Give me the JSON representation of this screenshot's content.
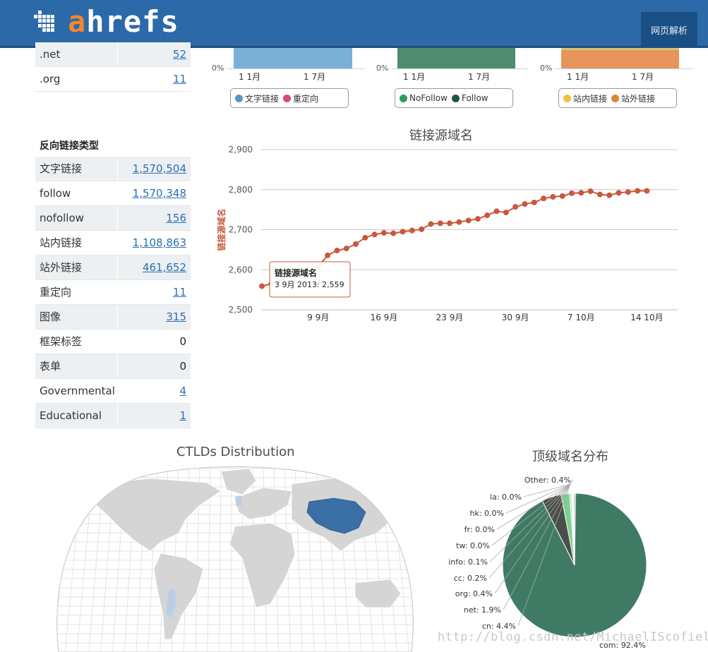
{
  "header": {
    "logo_prefix": "a",
    "logo_suffix": "hrefs",
    "nav_button": "网页解析"
  },
  "tld_table_top": [
    {
      "label": ".net",
      "value": "52"
    },
    {
      "label": ".org",
      "value": "11"
    }
  ],
  "backlink_types": {
    "title": "反向链接类型",
    "rows": [
      {
        "label": "文字链接",
        "value": "1,570,504",
        "link": true
      },
      {
        "label": "follow",
        "value": "1,570,348",
        "link": true
      },
      {
        "label": "nofollow",
        "value": "156",
        "link": true
      },
      {
        "label": "站内链接",
        "value": "1,108,863",
        "link": true
      },
      {
        "label": "站外链接",
        "value": "461,652",
        "link": true
      },
      {
        "label": "重定向",
        "value": "11",
        "link": true
      },
      {
        "label": "图像",
        "value": "315",
        "link": true
      },
      {
        "label": "框架标签",
        "value": "0",
        "link": false
      },
      {
        "label": "表单",
        "value": "0",
        "link": false
      },
      {
        "label": "Governmental",
        "value": "4",
        "link": true
      },
      {
        "label": "Educational",
        "value": "1",
        "link": true
      }
    ]
  },
  "mini_charts": [
    {
      "zero": "0%",
      "ticks": [
        "1 1月",
        "1 7月"
      ],
      "color": "#7bafd6",
      "legend": [
        {
          "label": "文字链接",
          "color": "#5b95c8"
        },
        {
          "label": "重定向",
          "color": "#d9497a"
        }
      ]
    },
    {
      "zero": "0%",
      "ticks": [
        "1 1月",
        "1 7月"
      ],
      "color": "#4f8c6e",
      "legend": [
        {
          "label": "NoFollow",
          "color": "#2c9c5e"
        },
        {
          "label": "Follow",
          "color": "#1c5a3c"
        }
      ]
    },
    {
      "zero": "0%",
      "ticks": [
        "1 1月",
        "1 7月"
      ],
      "color": "#e7955b",
      "legend": [
        {
          "label": "站内链接",
          "color": "#f3bf3c"
        },
        {
          "label": "站外链接",
          "color": "#db8537"
        }
      ]
    }
  ],
  "colors": {
    "line": "#c9583d",
    "grid": "#c8c8c8",
    "pie_main": "#3f7b64",
    "map_land": "#d5d5d5",
    "map_highlight": "#3a6fa5"
  },
  "chart_data": [
    {
      "type": "line",
      "title": "链接源域名",
      "ylabel": "链接源域名",
      "xlabel": "",
      "ylim": [
        2500,
        2900
      ],
      "yticks": [
        "2,900",
        "2,800",
        "2,700",
        "2,600",
        "2,500"
      ],
      "xtick_labels": [
        "9 9月",
        "16 9月",
        "23 9月",
        "30 9月",
        "7 10月",
        "14 10月"
      ],
      "x": [
        "3 9月",
        "4 9月",
        "5 9月",
        "6 9月",
        "7 9月",
        "8 9月",
        "9 9月",
        "10 9月",
        "11 9月",
        "12 9月",
        "13 9月",
        "14 9月",
        "15 9月",
        "16 9月",
        "17 9月",
        "18 9月",
        "19 9月",
        "20 9月",
        "21 9月",
        "22 9月",
        "23 9月",
        "24 9月",
        "25 9月",
        "26 9月",
        "27 9月",
        "28 9月",
        "29 9月",
        "30 9月",
        "1 10月",
        "2 10月",
        "3 10月",
        "4 10月",
        "5 10月",
        "6 10月",
        "7 10月",
        "8 10月",
        "9 10月",
        "10 10月",
        "11 10月",
        "12 10月",
        "13 10月",
        "14 10月"
      ],
      "series": [
        {
          "name": "链接源域名",
          "values": [
            2559,
            2565,
            2578,
            2590,
            2598,
            2603,
            2608,
            2636,
            2648,
            2653,
            2664,
            2680,
            2688,
            2692,
            2691,
            2695,
            2698,
            2701,
            2714,
            2716,
            2716,
            2719,
            2723,
            2727,
            2736,
            2746,
            2743,
            2757,
            2764,
            2768,
            2778,
            2782,
            2784,
            2791,
            2792,
            2796,
            2788,
            2786,
            2792,
            2794,
            2797,
            2797
          ]
        }
      ],
      "tooltip": {
        "title": "链接源域名",
        "text": "3 9月 2013: 2,559"
      },
      "grid": true,
      "legend": "none"
    },
    {
      "type": "pie",
      "title": "顶级域名分布",
      "labels": [
        "com",
        "cn",
        "net",
        "org",
        "cc",
        "info",
        "tw",
        "fr",
        "hk",
        "la",
        "Other"
      ],
      "label_texts": [
        "com: 92.4%",
        "cn: 4.4%",
        "net: 1.9%",
        "org: 0.4%",
        "cc: 0.2%",
        "info: 0.1%",
        "tw: 0.0%",
        "fr: 0.0%",
        "hk: 0.0%",
        "la: 0.0%",
        "Other: 0.4%"
      ],
      "values": [
        92.4,
        4.4,
        1.9,
        0.4,
        0.2,
        0.1,
        0.0,
        0.0,
        0.0,
        0.0,
        0.4
      ],
      "colors": [
        "#3f7b64",
        "#4a4f4a",
        "#7ccf93",
        "#a5e0b5",
        "#cfe9d6",
        "#dcdcdc",
        "#e6e6e6",
        "#e6e6e6",
        "#e6e6e6",
        "#e6e6e6",
        "#b9c4be"
      ]
    }
  ],
  "map": {
    "title": "CTLDs Distribution",
    "highlight": "China"
  },
  "watermark": "http://blog.csdn.net/MichaelIScofield"
}
